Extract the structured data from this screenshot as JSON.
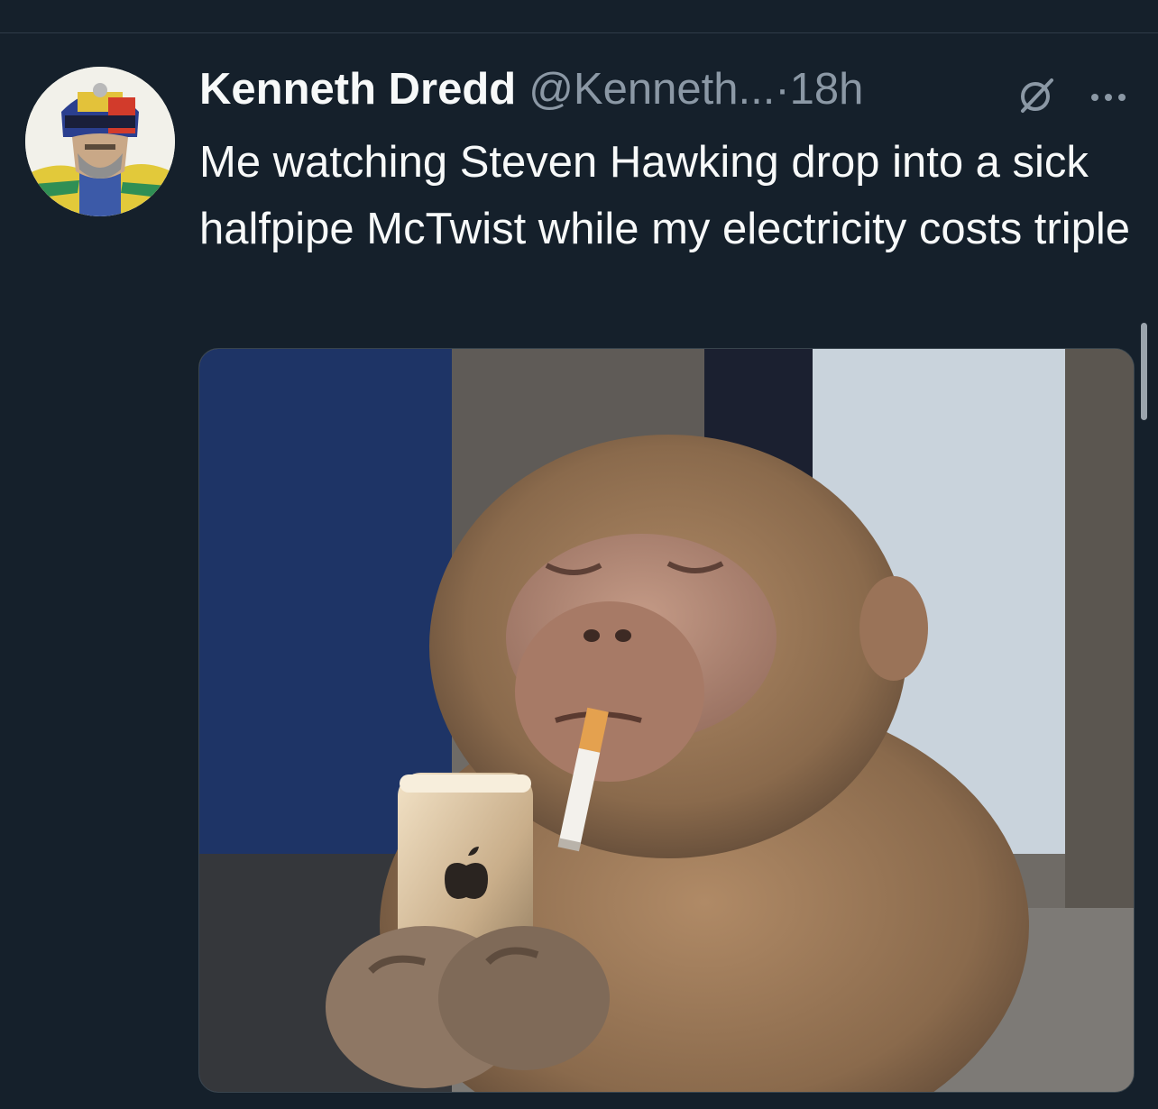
{
  "tweet": {
    "display_name": "Kenneth Dredd",
    "handle": "@Kenneth...",
    "separator": "·",
    "timestamp": "18h",
    "text": "Me watching Steven Hawking drop into a sick halfpipe McTwist while my electricity costs triple"
  },
  "icons": {
    "avatar": "avatar-judge-dredd",
    "grok": "grok-icon",
    "more": "more-icon"
  },
  "colors": {
    "background": "#15202b",
    "primary_text": "#f7f9f9",
    "secondary_text": "#8b98a5"
  }
}
